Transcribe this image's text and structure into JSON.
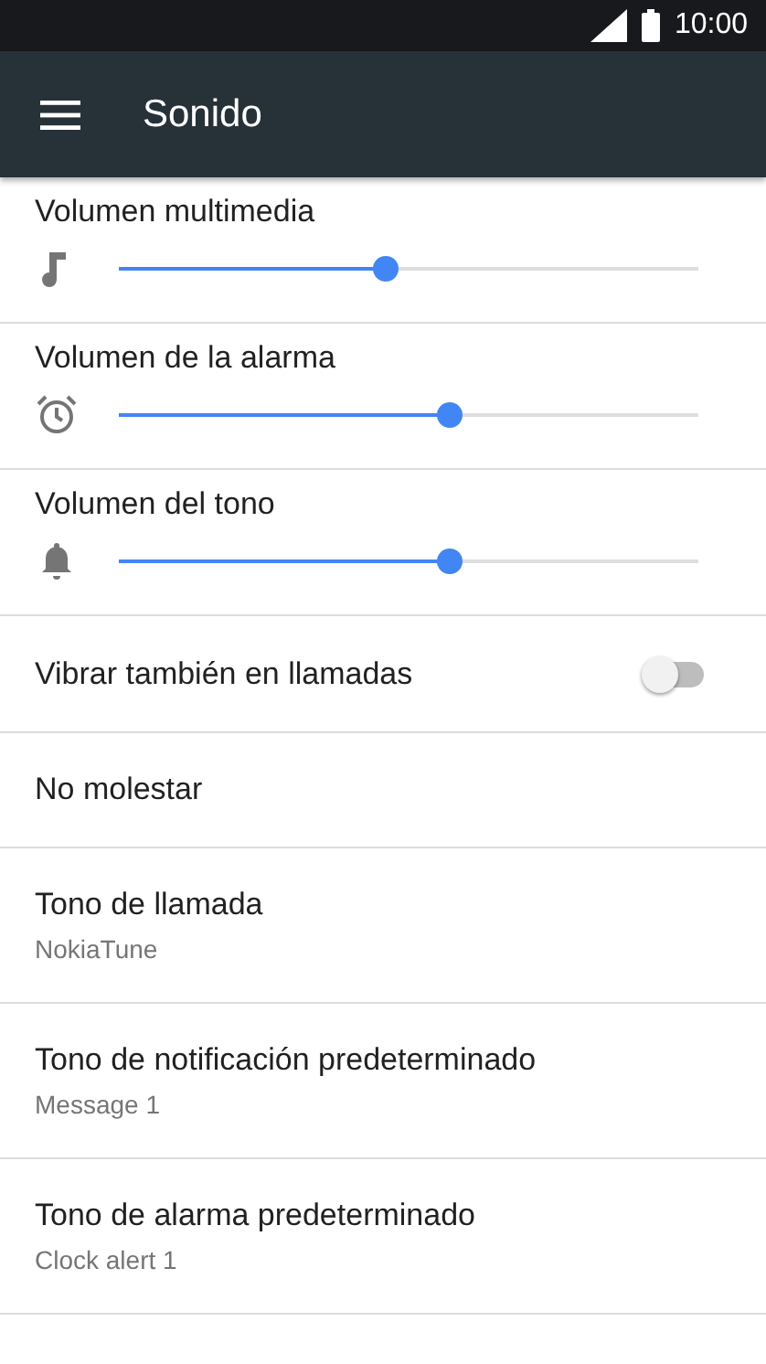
{
  "status_bar": {
    "time": "10:00"
  },
  "toolbar": {
    "title": "Sonido"
  },
  "volumes": [
    {
      "label": "Volumen multimedia",
      "kind": "music",
      "level": 0.46
    },
    {
      "label": "Volumen de la alarma",
      "kind": "alarm",
      "level": 0.57
    },
    {
      "label": "Volumen del tono",
      "kind": "bell",
      "level": 0.57
    }
  ],
  "settings": [
    {
      "kind": "switch",
      "title": "Vibrar también en llamadas",
      "on": false
    },
    {
      "kind": "plain",
      "title": "No molestar"
    },
    {
      "kind": "summary",
      "title": "Tono de llamada",
      "summary": "NokiaTune"
    },
    {
      "kind": "summary",
      "title": "Tono de notificación predeterminado",
      "summary": "Message 1"
    },
    {
      "kind": "summary",
      "title": "Tono de alarma predeterminado",
      "summary": "Clock alert 1"
    }
  ]
}
